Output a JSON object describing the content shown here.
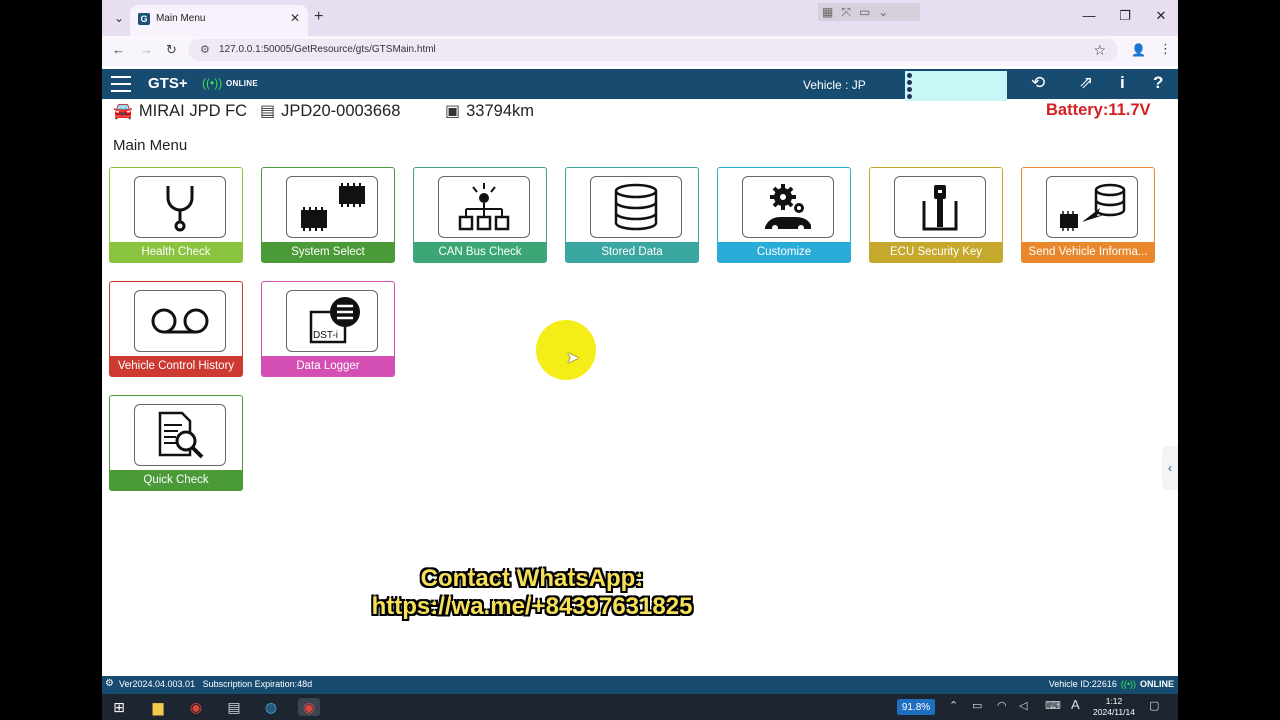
{
  "browser": {
    "tab_title": "Main Menu",
    "url": "127.0.0.1:50005/GetResource/gts/GTSMain.html"
  },
  "app": {
    "brand": "GTS+",
    "online": "ONLINE",
    "vehicle_label": "Vehicle : JP"
  },
  "vehicle": {
    "model": "MIRAI JPD FC",
    "vin": "JPD20-0003668",
    "odometer": "33794km",
    "battery": "Battery:11.7V"
  },
  "page_title": "Main Menu",
  "tiles": [
    {
      "label": "Health Check",
      "color": "#8ac43f",
      "icon": "stethoscope-icon"
    },
    {
      "label": "System Select",
      "color": "#4a9a37",
      "icon": "ecu-chips-icon"
    },
    {
      "label": "CAN Bus Check",
      "color": "#3ba776",
      "icon": "network-icon"
    },
    {
      "label": "Stored Data",
      "color": "#3aa6a0",
      "icon": "database-icon"
    },
    {
      "label": "Customize",
      "color": "#2aacd9",
      "icon": "gears-car-icon"
    },
    {
      "label": "ECU Security Key",
      "color": "#c6a92c",
      "icon": "key-icon"
    },
    {
      "label": "Send Vehicle Informa...",
      "color": "#e8872b",
      "icon": "send-data-icon"
    },
    {
      "label": "Vehicle Control History",
      "color": "#cc3a32",
      "icon": "voicemail-icon"
    },
    {
      "label": "Data Logger",
      "color": "#d34fb3",
      "icon": "dst-logger-icon"
    },
    {
      "label": "Quick Check",
      "color": "#4a9a37",
      "icon": "document-search-icon"
    }
  ],
  "overlay": {
    "line1": "Contact WhatsApp:",
    "line2": "https://wa.me/+84397631825"
  },
  "status": {
    "version": "Ver2024.04.003.01",
    "subscription": "Subscription Expiration:48d",
    "vehicle_id": "Vehicle ID:22616",
    "online": "ONLINE"
  },
  "taskbar": {
    "battery": "91.8%",
    "ime": "A",
    "time": "1:12",
    "date": "2024/11/14"
  }
}
